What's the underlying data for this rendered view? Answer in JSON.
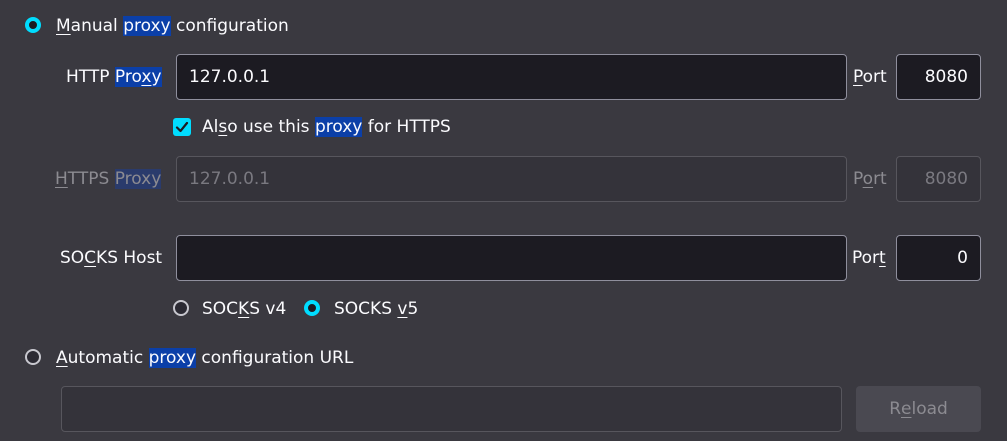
{
  "manual": {
    "selected": true,
    "label_pre": "",
    "label_mn": "M",
    "label_mid": "anual ",
    "label_hl": "proxy",
    "label_post": " configuration"
  },
  "http": {
    "label_pre": "HTTP ",
    "label_hl_a": "Pro",
    "label_hl_mn": "x",
    "label_hl_b": "y",
    "value": "127.0.0.1",
    "port_label_mn": "P",
    "port_label_rest": "ort",
    "port_value": "8080"
  },
  "also_https": {
    "checked": true,
    "label_a": "Al",
    "label_mn": "s",
    "label_b": "o use this ",
    "label_hl": "proxy",
    "label_c": " for HTTPS"
  },
  "https": {
    "label_mn": "H",
    "label_rest": "TTPS ",
    "label_hl": "Proxy",
    "value": "127.0.0.1",
    "port_label_a": "P",
    "port_label_mn": "o",
    "port_label_b": "rt",
    "port_value": "8080"
  },
  "socks": {
    "label_a": "SO",
    "label_mn": "C",
    "label_b": "KS Host",
    "value": "",
    "port_label_a": "Por",
    "port_label_mn": "t",
    "port_value": "0",
    "v4_a": "SOC",
    "v4_mn": "K",
    "v4_b": "S v4",
    "v5_a": "SOCKS ",
    "v5_mn": "v",
    "v5_b": "5",
    "v5_selected": true
  },
  "auto": {
    "selected": false,
    "label_mn": "A",
    "label_mid": "utomatic ",
    "label_hl": "proxy",
    "label_post": " configuration URL",
    "url_value": "",
    "reload_a": "R",
    "reload_mn": "e",
    "reload_b": "load"
  },
  "colors": {
    "background": "#3a3940",
    "accent": "#00ddff",
    "highlight": "#0b3fa8",
    "field_bg": "#1c1b22"
  }
}
